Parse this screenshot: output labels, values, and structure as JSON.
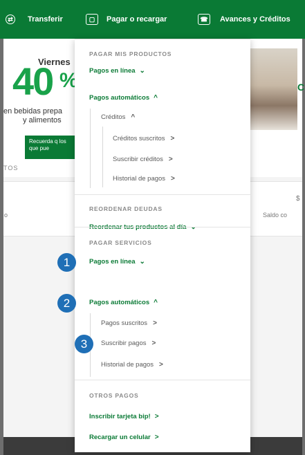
{
  "nav": {
    "transfer_label": "Transferir",
    "pay_label": "Pagar o recargar",
    "advances_label": "Avances y Créditos"
  },
  "background": {
    "promo": {
      "day": "Viernes",
      "big": "40",
      "pct": "%",
      "sub_line1": "en bebidas prepa",
      "sub_line2": "y alimentos",
      "button_label": "Recuerda q los que pue",
      "tos_text": "TOS"
    },
    "row_left_text": "o",
    "row_right_text": "Saldo co",
    "row_right_top": "$"
  },
  "menu": {
    "s1_header": "PAGAR MIS PRODUCTOS",
    "s1_online": "Pagos en línea",
    "s1_auto": "Pagos automáticos",
    "s1_credits": "Créditos",
    "s1_subscribed": "Créditos suscritos",
    "s1_subscribe": "Suscribir créditos",
    "s1_history": "Historial de pagos",
    "s2_header": "REORDENAR DEUDAS",
    "s2_item": "Reordenar tus productos al día",
    "s3_header": "PAGAR SERVICIOS",
    "s3_online": "Pagos en línea",
    "s3_auto": "Pagos automáticos",
    "s3_subscribed": "Pagos suscritos",
    "s3_subscribe": "Suscribir pagos",
    "s3_history": "Historial de pagos",
    "s4_header": "OTROS PAGOS",
    "s4_bip": "Inscribir tarjeta bip!",
    "s4_recharge": "Recargar un celular"
  },
  "markers": [
    "1",
    "2",
    "3"
  ],
  "colors": {
    "brand_green": "#0a7a35",
    "marker_blue": "#1f6fb6"
  },
  "icons": {
    "expand": "chevron-down-icon",
    "collapse": "chevron-up-icon",
    "go": "chevron-right-icon"
  }
}
